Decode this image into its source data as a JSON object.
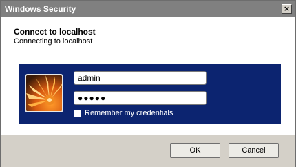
{
  "window": {
    "title": "Windows Security",
    "close_glyph": "×"
  },
  "header": {
    "title": "Connect to localhost",
    "subtitle": "Connecting to localhost"
  },
  "credentials": {
    "username_value": "admin",
    "password_value": "●●●●●",
    "remember_label": "Remember my credentials",
    "remember_checked": false,
    "avatar_icon": "user-tile-flower-icon"
  },
  "buttons": {
    "ok_label": "OK",
    "cancel_label": "Cancel"
  },
  "colors": {
    "titlebar": "#808080",
    "credential_panel": "#0c2470",
    "dialog_background": "#d4d0c8"
  }
}
